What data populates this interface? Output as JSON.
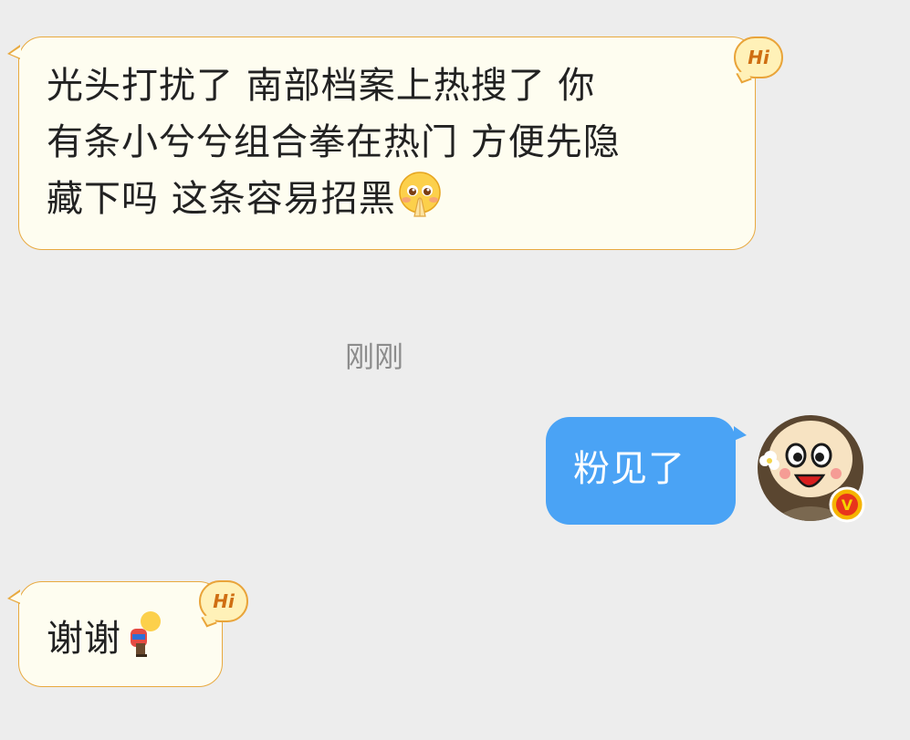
{
  "messages": [
    {
      "direction": "incoming",
      "lines": [
        "光头打扰了 南部档案上热搜了 你",
        "有条小兮兮组合拳在热门 方便先隐",
        "藏下吗 这条容易招黑"
      ],
      "badge": "Hi",
      "emoji": "pleading-hands-emoji"
    },
    {
      "direction": "outgoing",
      "text": "粉见了"
    },
    {
      "direction": "incoming",
      "text": "谢谢",
      "badge": "Hi",
      "emoji": "bowing-person-emoji"
    }
  ],
  "timestamp": "刚刚",
  "colors": {
    "background": "#ededed",
    "incoming_bubble": "#fefdf0",
    "incoming_border": "#e8a93f",
    "outgoing_bubble": "#4aa3f5",
    "timestamp": "#8c8c8c",
    "verified_badge": "#f5b400"
  },
  "avatar": {
    "name": "cartoon-face-avatar",
    "badge": "V"
  }
}
